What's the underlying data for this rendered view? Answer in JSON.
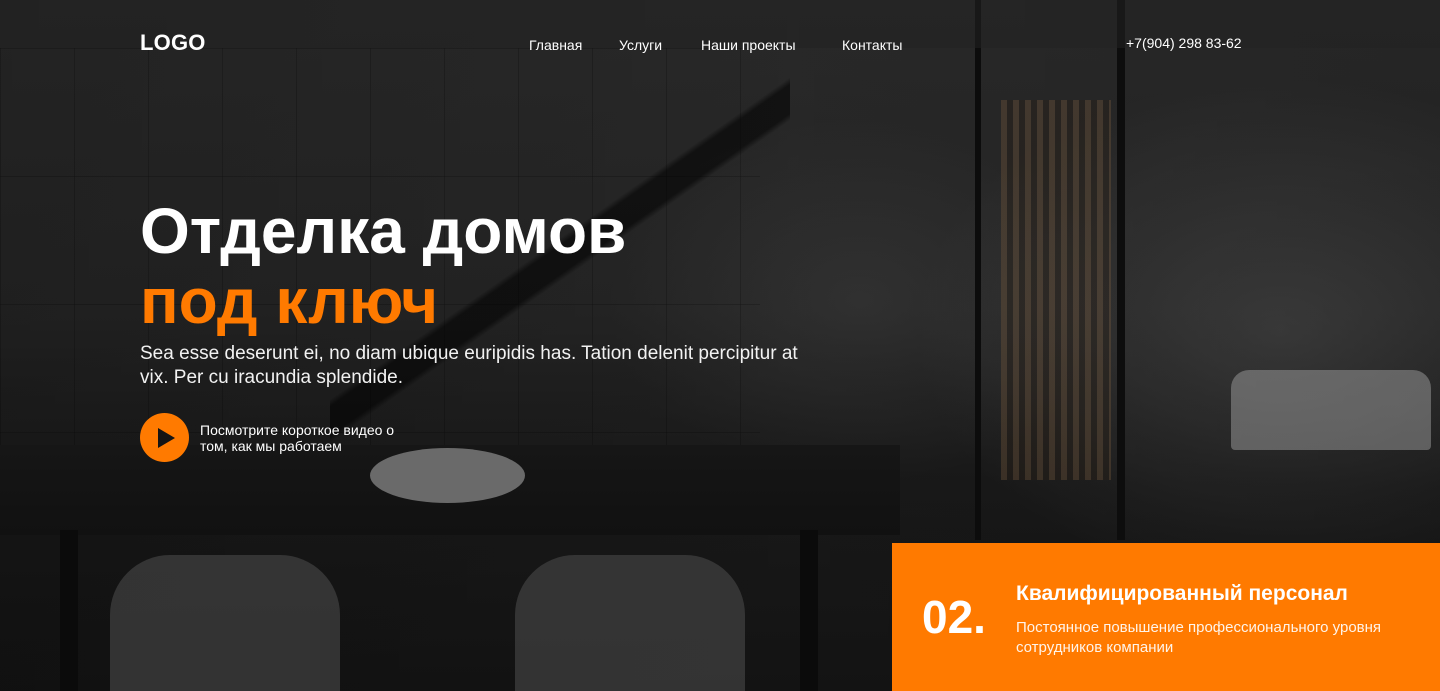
{
  "header": {
    "logo": "LOGO",
    "nav": [
      {
        "label": "Главная"
      },
      {
        "label": "Услуги"
      },
      {
        "label": "Наши проекты"
      },
      {
        "label": "Контакты"
      }
    ],
    "phone": "+7(904) 298 83-62"
  },
  "hero": {
    "title_line1": "Отделка домов",
    "title_line2": "под ключ",
    "lead": "Sea esse deserunt ei, no diam ubique euripidis has. Tation delenit percipitur at vix. Per cu iracundia splendide.",
    "video_text": "Посмотрите короткое видео о том, как мы работаем",
    "play_icon": "play-icon"
  },
  "feature": {
    "number": "02.",
    "title": "Квалифицированный персонал",
    "description": "Постоянное повышение профессионального уровня сотрудников компании"
  },
  "colors": {
    "accent": "#ff7a00",
    "text": "#ffffff",
    "overlay": "#1a1a1a"
  }
}
